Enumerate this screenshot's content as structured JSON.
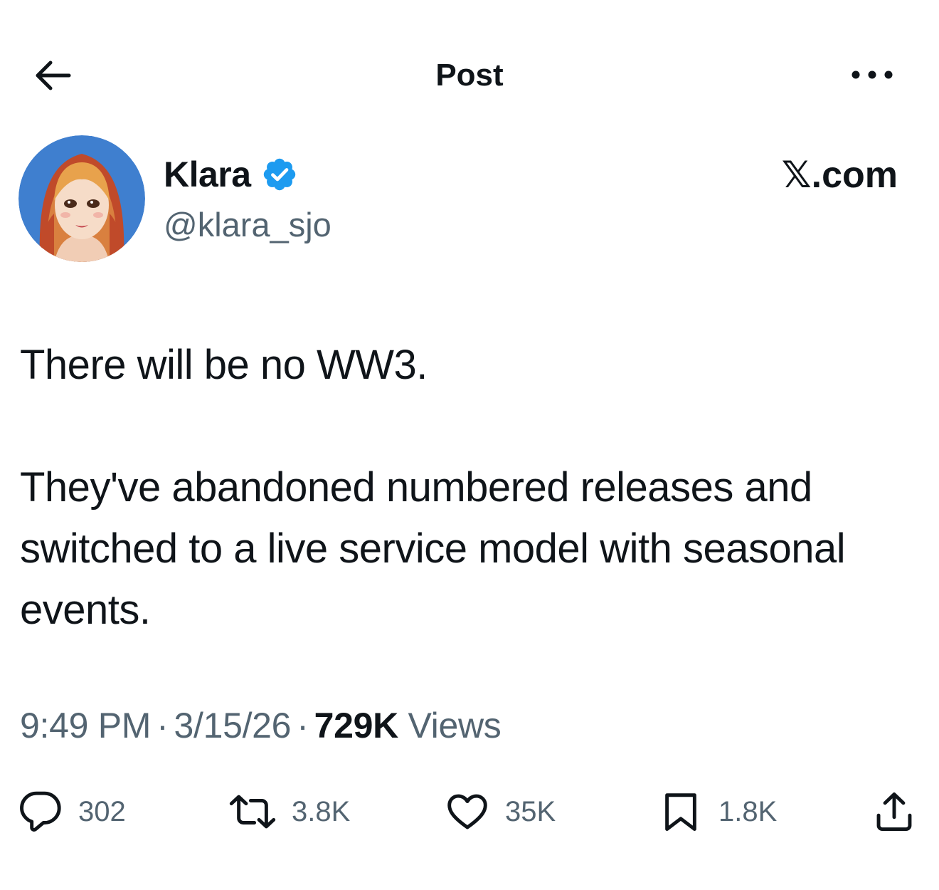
{
  "header": {
    "title": "Post",
    "back_icon": "arrow-left-icon",
    "more_icon": "more-horizontal-icon"
  },
  "author": {
    "name": "Klara",
    "handle": "@klara_sjo",
    "verified": true,
    "verified_color": "#1d9bf0",
    "site_label": "𝕏.com"
  },
  "post": {
    "paragraphs": [
      "There will be no WW3.",
      "They've abandoned numbered releases and switched to a live service model with seasonal events."
    ]
  },
  "meta": {
    "time": "9:49 PM",
    "date": "3/15/26",
    "views_count": "729K",
    "views_label": "Views",
    "separator": "·"
  },
  "actions": {
    "replies": "302",
    "reposts": "3.8K",
    "likes": "35K",
    "bookmarks": "1.8K"
  },
  "colors": {
    "text": "#0f1419",
    "secondary": "#536471",
    "accent": "#1d9bf0"
  }
}
